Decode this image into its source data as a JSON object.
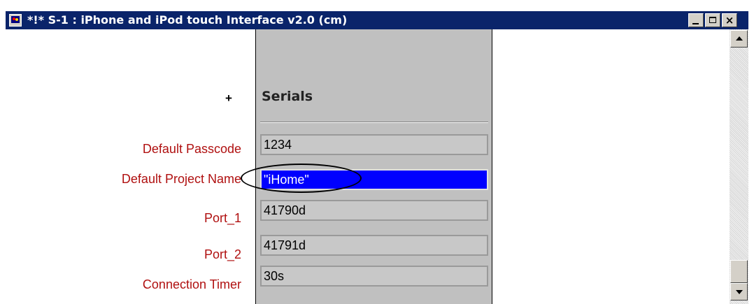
{
  "window": {
    "title": "*!* S-1 : iPhone and iPod touch Interface v2.0 (cm)",
    "titlebar_color": "#0a246a",
    "controls": {
      "minimize": "minimize-icon",
      "maximize": "maximize-icon",
      "close_glyph": "×"
    }
  },
  "editor": {
    "add_symbol": "+",
    "column_header": "Serials",
    "highlight_color": "#0000ff",
    "label_color": "#b01010",
    "rows": [
      {
        "label": "Default Passcode",
        "value": "1234"
      },
      {
        "label": "Default Project Name",
        "value": "\"iHome\"",
        "selected": true
      },
      {
        "label": "Port_1",
        "value": "41790d"
      },
      {
        "label": "Port_2",
        "value": "41791d"
      },
      {
        "label": "Connection Timer",
        "value": "30s"
      }
    ]
  },
  "scrollbar": {
    "up": "arrow-up-icon",
    "down": "arrow-down-icon"
  }
}
